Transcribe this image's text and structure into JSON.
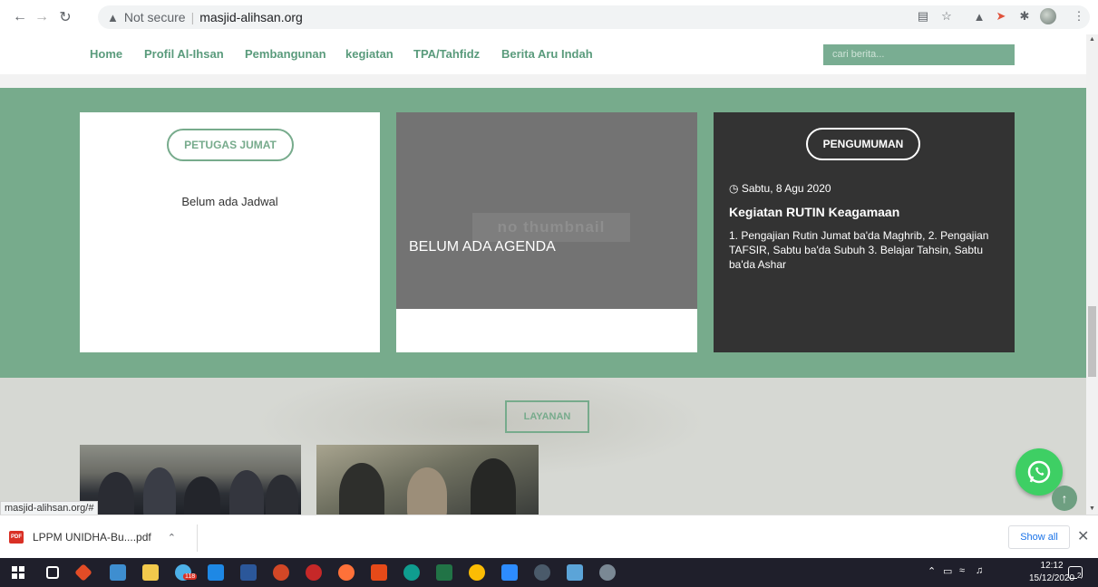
{
  "browser": {
    "security_label": "Not secure",
    "url": "masjid-alihsan.org",
    "status_url": "masjid-alihsan.org/#"
  },
  "site_nav": {
    "links": [
      "Home",
      "Profil Al-Ihsan",
      "Pembangunan",
      "kegiatan",
      "TPA/Tahfidz",
      "Berita Aru Indah"
    ],
    "search_placeholder": "cari berita..."
  },
  "petugas": {
    "heading": "PETUGAS JUMAT",
    "message": "Belum ada Jadwal"
  },
  "agenda": {
    "thumbnail_text": "no thumbnail",
    "message": "BELUM ADA AGENDA"
  },
  "pengumuman": {
    "heading": "PENGUMUMAN",
    "date": "Sabtu, 8 Agu 2020",
    "title": "Kegiatan RUTIN Keagamaan",
    "body": "1. Pengajian Rutin Jumat ba'da Maghrib, 2. Pengajian TAFSIR, Sabtu ba'da Subuh 3. Belajar Tahsin, Sabtu ba'da Ashar"
  },
  "layanan": {
    "heading": "LAYANAN"
  },
  "downloads": {
    "file_name": "LPPM UNIDHA-Bu....pdf",
    "file_type_badge": "PDF",
    "show_all": "Show all"
  },
  "taskbar": {
    "badge_count": "118",
    "clock_time": "12:12",
    "clock_date": "15/12/2020",
    "notification_count": "2"
  },
  "colors": {
    "accent_green": "#77ab8c",
    "dark_card": "#333333",
    "whatsapp_green": "#3ecf64"
  }
}
